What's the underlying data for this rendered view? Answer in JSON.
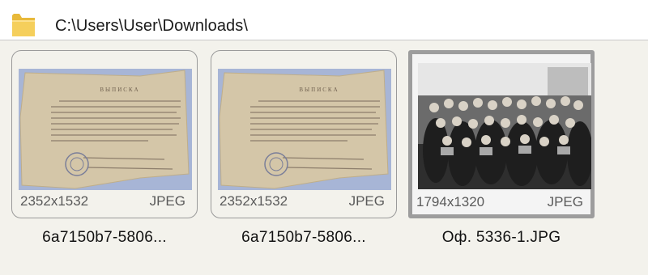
{
  "address_bar": {
    "path": "C:\\Users\\User\\Downloads\\",
    "icon": "folder-icon"
  },
  "files": [
    {
      "dimensions": "2352x1532",
      "type": "JPEG",
      "name": "6a7150b7-5806...",
      "thumbnail": "aged-document-scan",
      "selected": false
    },
    {
      "dimensions": "2352x1532",
      "type": "JPEG",
      "name": "6a7150b7-5806...",
      "thumbnail": "aged-document-scan",
      "selected": false
    },
    {
      "dimensions": "1794x1320",
      "type": "JPEG",
      "name": "Оф.  5336-1.JPG",
      "thumbnail": "group-photo-black-and-white",
      "selected": true
    }
  ],
  "colors": {
    "window_bg": "#f3f2ec",
    "selection_border": "#9d9d9d",
    "folder": "#f2c84b"
  }
}
